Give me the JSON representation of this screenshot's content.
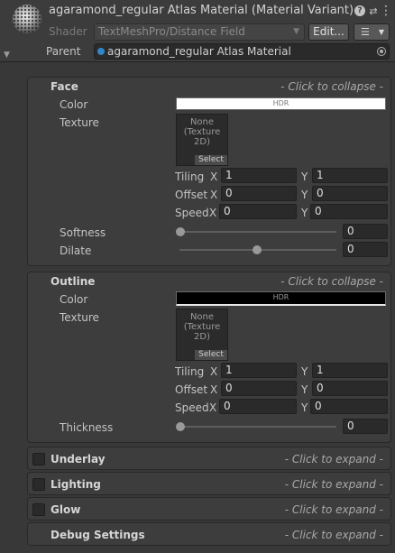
{
  "header": {
    "title": "agaramond_regular Atlas Material (Material Variant)",
    "shader_label": "Shader",
    "shader_value": "TextMeshPro/Distance Field",
    "edit_label": "Edit...",
    "parent_label": "Parent",
    "parent_value": "agaramond_regular Atlas Material"
  },
  "face": {
    "title": "Face",
    "hint": "- Click to collapse -",
    "color_label": "Color",
    "color_hdr": "HDR",
    "color_value": "#ffffff",
    "texture_label": "Texture",
    "texture_text": "None (Texture 2D)",
    "select_label": "Select",
    "tiling_label": "Tiling",
    "offset_label": "Offset",
    "speed_label": "Speed",
    "x_label": "X",
    "y_label": "Y",
    "tiling_x": "1",
    "tiling_y": "1",
    "offset_x": "0",
    "offset_y": "0",
    "speed_x": "0",
    "speed_y": "0",
    "softness_label": "Softness",
    "softness_value": "0",
    "dilate_label": "Dilate",
    "dilate_value": "0"
  },
  "outline": {
    "title": "Outline",
    "hint": "- Click to collapse -",
    "color_label": "Color",
    "color_hdr": "HDR",
    "color_value": "#000000",
    "texture_label": "Texture",
    "texture_text": "None (Texture 2D)",
    "select_label": "Select",
    "tiling_label": "Tiling",
    "offset_label": "Offset",
    "speed_label": "Speed",
    "x_label": "X",
    "y_label": "Y",
    "tiling_x": "1",
    "tiling_y": "1",
    "offset_x": "0",
    "offset_y": "0",
    "speed_x": "0",
    "speed_y": "0",
    "thickness_label": "Thickness",
    "thickness_value": "0"
  },
  "underlay": {
    "title": "Underlay",
    "hint": "- Click to expand -"
  },
  "lighting": {
    "title": "Lighting",
    "hint": "- Click to expand -"
  },
  "glow": {
    "title": "Glow",
    "hint": "- Click to expand -"
  },
  "debug": {
    "title": "Debug Settings",
    "hint": "- Click to expand -"
  },
  "icons": [
    "material-preview-icon",
    "help-icon",
    "presets-icon",
    "kebab-menu-icon",
    "foldout-arrow-icon",
    "object-picker-icon"
  ]
}
